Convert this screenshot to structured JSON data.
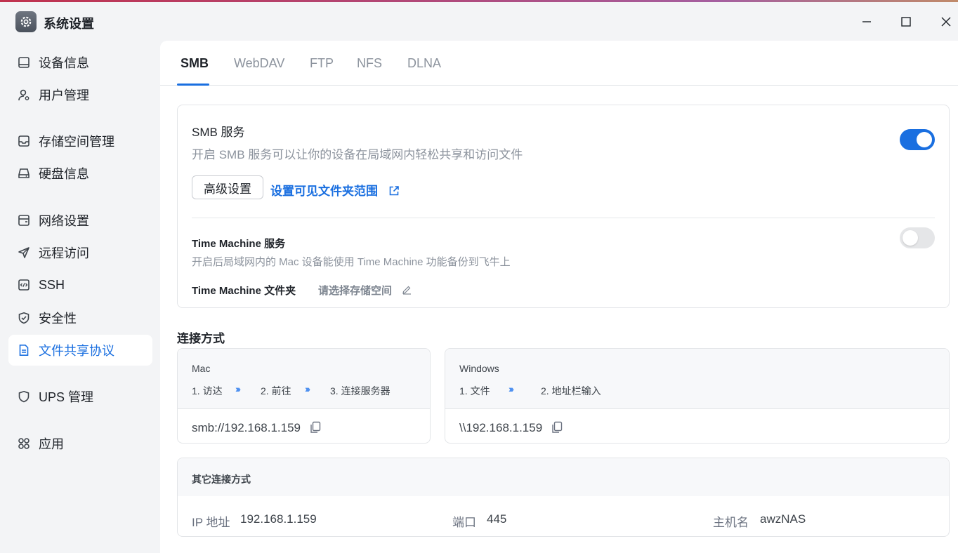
{
  "window": {
    "title": "系统设置",
    "app_icon": "gear-icon"
  },
  "sidebar": {
    "items": [
      {
        "label": "设备信息",
        "icon": "device-info-icon"
      },
      {
        "label": "用户管理",
        "icon": "user-gear-icon"
      },
      {
        "label": "存储空间管理",
        "icon": "storage-icon"
      },
      {
        "label": "硬盘信息",
        "icon": "hard-disk-icon"
      },
      {
        "label": "网络设置",
        "icon": "network-icon"
      },
      {
        "label": "远程访问",
        "icon": "send-icon"
      },
      {
        "label": "SSH",
        "icon": "code-icon"
      },
      {
        "label": "安全性",
        "icon": "shield-check-icon"
      },
      {
        "label": "文件共享协议",
        "icon": "document-icon",
        "active": true
      },
      {
        "label": "UPS 管理",
        "icon": "shield-icon"
      },
      {
        "label": "应用",
        "icon": "apps-icon"
      }
    ]
  },
  "tabs": [
    "SMB",
    "WebDAV",
    "FTP",
    "NFS",
    "DLNA"
  ],
  "active_tab": "SMB",
  "smb": {
    "title": "SMB 服务",
    "description": "开启 SMB 服务可以让你的设备在局域网内轻松共享和访问文件",
    "enabled": true,
    "advanced_button": "高级设置",
    "folder_scope_link": "设置可见文件夹范围"
  },
  "time_machine": {
    "title": "Time Machine 服务",
    "description": "开启后局域网内的 Mac 设备能使用 Time Machine 功能备份到飞牛上",
    "enabled": false,
    "folder_label": "Time Machine 文件夹",
    "folder_value": "请选择存储空间"
  },
  "connection": {
    "section_title": "连接方式",
    "mac": {
      "name": "Mac",
      "steps": [
        "1. 访达",
        "2. 前往",
        "3. 连接服务器"
      ],
      "address": "smb://192.168.1.159"
    },
    "windows": {
      "name": "Windows",
      "steps": [
        "1. 文件",
        "2. 地址栏输入"
      ],
      "address": "\\\\192.168.1.159"
    },
    "other": {
      "title": "其它连接方式",
      "ip_label": "IP 地址",
      "ip_value": "192.168.1.159",
      "port_label": "端口",
      "port_value": "445",
      "host_label": "主机名",
      "host_value": "awzNAS"
    }
  },
  "colors": {
    "accent": "#1a6fe0",
    "toggle_off": "#e5e6e8"
  }
}
